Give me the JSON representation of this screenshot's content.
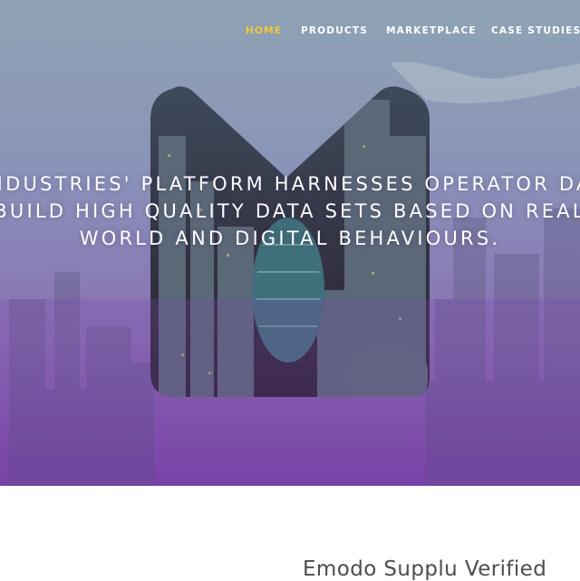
{
  "nav": {
    "items": [
      {
        "label": "HOME",
        "active": true
      },
      {
        "label": "PRODUCTS",
        "active": false
      },
      {
        "label": "MARKETPLACE",
        "active": false
      },
      {
        "label": "CASE STUDIES",
        "active": false
      }
    ],
    "active_color": "#f2c736"
  },
  "hero": {
    "tagline_lines": [
      "HUQ INDUSTRIES' PLATFORM HARNESSES OPERATOR DATA TO",
      "BUILD HIGH QUALITY DATA SETS BASED ON REAL",
      "WORLD AND DIGITAL BEHAVIOURS."
    ],
    "gradient_top": "#7f93a6",
    "gradient_bottom": "#7a3fa6",
    "logo": "M-shaped city skyline emblem"
  },
  "section": {
    "heading": "Emodo Supplu Verified"
  }
}
